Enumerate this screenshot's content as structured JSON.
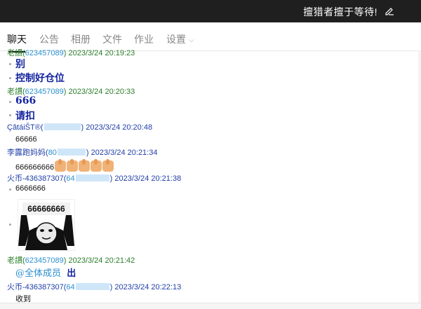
{
  "titlebar": {
    "title": "擅猎者擅于等待!",
    "edit_icon": "edit-icon"
  },
  "tabs": [
    {
      "label": "聊天"
    },
    {
      "label": "公告"
    },
    {
      "label": "相册"
    },
    {
      "label": "文件"
    },
    {
      "label": "作业"
    },
    {
      "label": "设置"
    }
  ],
  "messages": [
    {
      "sender": "老謴(",
      "qq": "623457089",
      "tail": ")",
      "time": "2023/3/24 20:19:23",
      "lines": [
        "别",
        "控制好仓位"
      ]
    },
    {
      "sender": "老謴(",
      "qq": "623457089",
      "tail": ")",
      "time": "2023/3/24 20:20:33",
      "lines": [
        "666",
        "请扣"
      ]
    },
    {
      "sender": "ÇâtáiŠT®(",
      "time": "2023/3/24 20:20:48",
      "text": "66666"
    },
    {
      "sender": "李露跑妈妈(",
      "qq": "80",
      "tail": ")",
      "time": "2023/3/24 20:21:34",
      "text": "666666666"
    },
    {
      "sender": "火币-436387307(",
      "qq": "64",
      "tail": ")",
      "time": "2023/3/24 20:21:38",
      "text": "6666666",
      "meme_text": "66666666"
    },
    {
      "sender": "老謴(",
      "qq": "623457089",
      "tail": ")",
      "time": "2023/3/24 20:21:42",
      "mention": "@全体成员",
      "text": "出"
    },
    {
      "sender": "火币-436387307(",
      "qq": "64",
      "tail": ")",
      "time": "2023/3/24 20:22:13",
      "text": "收到"
    }
  ]
}
